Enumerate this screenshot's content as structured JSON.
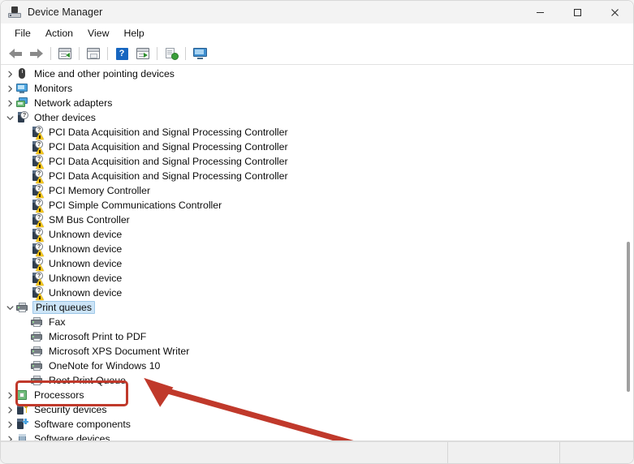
{
  "window": {
    "title": "Device Manager",
    "icon": "device-manager-icon",
    "controls": {
      "minimize": "minimize-button",
      "maximize": "maximize-button",
      "close": "close-button"
    }
  },
  "menubar": {
    "items": [
      {
        "label": "File",
        "name": "menu-file"
      },
      {
        "label": "Action",
        "name": "menu-action"
      },
      {
        "label": "View",
        "name": "menu-view"
      },
      {
        "label": "Help",
        "name": "menu-help"
      }
    ]
  },
  "toolbar": {
    "buttons": [
      {
        "name": "back-button",
        "icon": "back-arrow-icon"
      },
      {
        "name": "forward-button",
        "icon": "forward-arrow-icon"
      },
      {
        "name": "show-hide-console-tree-button",
        "icon": "console-tree-icon"
      },
      {
        "name": "properties-button",
        "icon": "properties-icon"
      },
      {
        "name": "help-button",
        "icon": "help-question-icon"
      },
      {
        "name": "update-driver-button",
        "icon": "update-driver-icon"
      },
      {
        "name": "scan-for-hardware-changes-button",
        "icon": "scan-hardware-icon"
      },
      {
        "name": "display-button",
        "icon": "display-monitor-icon"
      }
    ]
  },
  "tree": {
    "rows": [
      {
        "label": "Mice and other pointing devices",
        "icon": "mouse-icon",
        "indent": 0,
        "expander": "collapsed",
        "selected": false,
        "name": "tree-item-mice-and-other-pointing-devices"
      },
      {
        "label": "Monitors",
        "icon": "monitor-icon",
        "indent": 0,
        "expander": "collapsed",
        "selected": false,
        "name": "tree-item-monitors"
      },
      {
        "label": "Network adapters",
        "icon": "network-adapter-icon",
        "indent": 0,
        "expander": "collapsed",
        "selected": false,
        "name": "tree-item-network-adapters"
      },
      {
        "label": "Other devices",
        "icon": "unknown-device-icon",
        "indent": 0,
        "expander": "expanded",
        "selected": false,
        "name": "tree-item-other-devices"
      },
      {
        "label": "PCI Data Acquisition and Signal Processing Controller",
        "icon": "unknown-device-warning-icon",
        "indent": 1,
        "expander": "none",
        "selected": false,
        "name": "tree-item-pci-data-acquisition-1"
      },
      {
        "label": "PCI Data Acquisition and Signal Processing Controller",
        "icon": "unknown-device-warning-icon",
        "indent": 1,
        "expander": "none",
        "selected": false,
        "name": "tree-item-pci-data-acquisition-2"
      },
      {
        "label": "PCI Data Acquisition and Signal Processing Controller",
        "icon": "unknown-device-warning-icon",
        "indent": 1,
        "expander": "none",
        "selected": false,
        "name": "tree-item-pci-data-acquisition-3"
      },
      {
        "label": "PCI Data Acquisition and Signal Processing Controller",
        "icon": "unknown-device-warning-icon",
        "indent": 1,
        "expander": "none",
        "selected": false,
        "name": "tree-item-pci-data-acquisition-4"
      },
      {
        "label": "PCI Memory Controller",
        "icon": "unknown-device-warning-icon",
        "indent": 1,
        "expander": "none",
        "selected": false,
        "name": "tree-item-pci-memory-controller"
      },
      {
        "label": "PCI Simple Communications Controller",
        "icon": "unknown-device-warning-icon",
        "indent": 1,
        "expander": "none",
        "selected": false,
        "name": "tree-item-pci-simple-communications-controller"
      },
      {
        "label": "SM Bus Controller",
        "icon": "unknown-device-warning-icon",
        "indent": 1,
        "expander": "none",
        "selected": false,
        "name": "tree-item-sm-bus-controller"
      },
      {
        "label": "Unknown device",
        "icon": "unknown-device-warning-icon",
        "indent": 1,
        "expander": "none",
        "selected": false,
        "name": "tree-item-unknown-device-1"
      },
      {
        "label": "Unknown device",
        "icon": "unknown-device-warning-icon",
        "indent": 1,
        "expander": "none",
        "selected": false,
        "name": "tree-item-unknown-device-2"
      },
      {
        "label": "Unknown device",
        "icon": "unknown-device-warning-icon",
        "indent": 1,
        "expander": "none",
        "selected": false,
        "name": "tree-item-unknown-device-3"
      },
      {
        "label": "Unknown device",
        "icon": "unknown-device-warning-icon",
        "indent": 1,
        "expander": "none",
        "selected": false,
        "name": "tree-item-unknown-device-4"
      },
      {
        "label": "Unknown device",
        "icon": "unknown-device-warning-icon",
        "indent": 1,
        "expander": "none",
        "selected": false,
        "name": "tree-item-unknown-device-5"
      },
      {
        "label": "Print queues",
        "icon": "printer-icon",
        "indent": 0,
        "expander": "expanded",
        "selected": true,
        "name": "tree-item-print-queues"
      },
      {
        "label": "Fax",
        "icon": "printer-icon",
        "indent": 1,
        "expander": "none",
        "selected": false,
        "name": "tree-item-fax"
      },
      {
        "label": "Microsoft Print to PDF",
        "icon": "printer-icon",
        "indent": 1,
        "expander": "none",
        "selected": false,
        "name": "tree-item-microsoft-print-to-pdf"
      },
      {
        "label": "Microsoft XPS Document Writer",
        "icon": "printer-icon",
        "indent": 1,
        "expander": "none",
        "selected": false,
        "name": "tree-item-microsoft-xps-document-writer"
      },
      {
        "label": "OneNote for Windows 10",
        "icon": "printer-icon",
        "indent": 1,
        "expander": "none",
        "selected": false,
        "name": "tree-item-onenote-for-windows-10"
      },
      {
        "label": "Root Print Queue",
        "icon": "printer-icon",
        "indent": 1,
        "expander": "none",
        "selected": false,
        "name": "tree-item-root-print-queue"
      },
      {
        "label": "Processors",
        "icon": "processor-icon",
        "indent": 0,
        "expander": "collapsed",
        "selected": false,
        "name": "tree-item-processors"
      },
      {
        "label": "Security devices",
        "icon": "security-device-icon",
        "indent": 0,
        "expander": "collapsed",
        "selected": false,
        "name": "tree-item-security-devices"
      },
      {
        "label": "Software components",
        "icon": "software-component-icon",
        "indent": 0,
        "expander": "collapsed",
        "selected": false,
        "name": "tree-item-software-components"
      },
      {
        "label": "Software devices",
        "icon": "software-device-icon",
        "indent": 0,
        "expander": "collapsed",
        "selected": false,
        "name": "tree-item-software-devices"
      }
    ]
  },
  "statusbar": {
    "pane1": "",
    "pane2": "",
    "pane3": ""
  },
  "annotations": {
    "highlight_color": "#c0392b",
    "highlight_target": "Print queues",
    "arrow": "red-arrow-pointing-to-print-queues"
  }
}
